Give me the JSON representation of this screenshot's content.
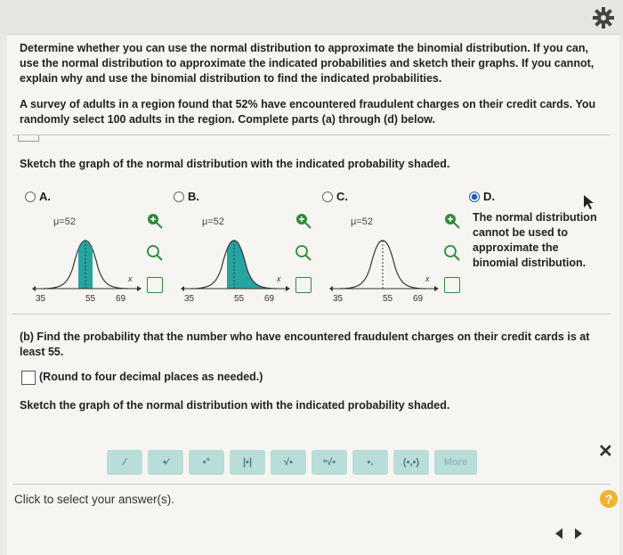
{
  "intro": {
    "line1": "Determine whether you can use the normal distribution to approximate the binomial distribution. If you can,",
    "line2": "use the normal distribution to approximate the indicated probabilities and sketch their graphs. If you cannot,",
    "line3": "explain why and use the binomial distribution to find the indicated probabilities."
  },
  "problem": {
    "line1": "A survey of adults in a region found that 52% have encountered fraudulent charges on their credit cards. You",
    "line2": "randomly select 100 adults in the region. Complete parts (a) through (d) below."
  },
  "part_a": {
    "prompt": "Sketch the graph of the normal distribution with the indicated probability shaded.",
    "options": [
      {
        "letter": "A.",
        "mu_label": "μ=52",
        "ticks": [
          "35",
          "55",
          "69"
        ],
        "selected": false
      },
      {
        "letter": "B.",
        "mu_label": "μ=52",
        "ticks": [
          "35",
          "55",
          "69"
        ],
        "selected": false
      },
      {
        "letter": "C.",
        "mu_label": "μ=52",
        "ticks": [
          "35",
          "55",
          "69"
        ],
        "selected": false
      },
      {
        "letter": "D.",
        "text_lines": [
          "The normal distribution",
          "cannot be used to",
          "approximate the",
          "binomial distribution."
        ],
        "selected": true
      }
    ]
  },
  "part_b": {
    "line1": "(b) Find the probability that the number who have encountered fraudulent charges on their credit cards is at",
    "line2": "least 55.",
    "round_note": "(Round to four decimal places as needed.)",
    "sketch_prompt": "Sketch the graph of the normal distribution with the indicated probability shaded."
  },
  "toolbar": {
    "buttons": [
      "⁄",
      "▪⁄",
      "▪°",
      "|▪|",
      "√▪",
      "ⁿ√▪",
      "▪.",
      "(▪,▪)",
      "More"
    ]
  },
  "footer": {
    "select_text": "Click to select your answer(s).",
    "help": "?"
  },
  "colors": {
    "accent": "#1a5fb4",
    "shade": "#25a4a0",
    "tool_green": "#2e8b3a",
    "help": "#f2b232"
  }
}
